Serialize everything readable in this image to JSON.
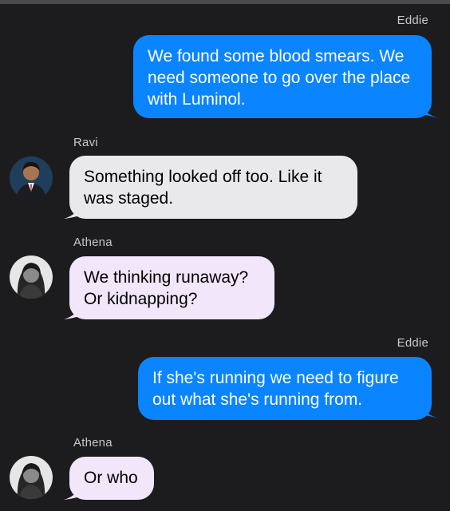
{
  "colors": {
    "background": "#1c1c1e",
    "outgoing_bubble": "#0a84ff",
    "incoming_bubble_ravi": "#e9e9eb",
    "incoming_bubble_athena": "#f2e6fb",
    "sender_label": "#c7c7cc"
  },
  "messages": [
    {
      "sender": "Eddie",
      "direction": "outgoing",
      "text": "We found some blood smears. We need someone to go over the place with Luminol."
    },
    {
      "sender": "Ravi",
      "direction": "incoming",
      "avatar": "ravi-avatar",
      "text": "Something looked off too. Like it was staged."
    },
    {
      "sender": "Athena",
      "direction": "incoming",
      "avatar": "athena-avatar",
      "text": "We thinking runaway? Or kidnapping?"
    },
    {
      "sender": "Eddie",
      "direction": "outgoing",
      "text": "If she's running we need to figure out what she's running from."
    },
    {
      "sender": "Athena",
      "direction": "incoming",
      "avatar": "athena-avatar",
      "text": "Or who"
    }
  ]
}
